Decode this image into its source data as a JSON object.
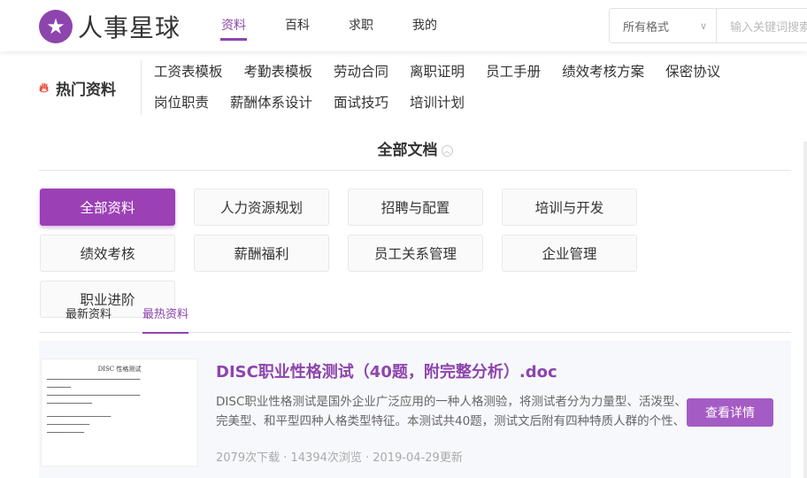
{
  "header": {
    "logo_text": "人事星球",
    "nav": [
      {
        "label": "资料",
        "active": true
      },
      {
        "label": "百科"
      },
      {
        "label": "求职"
      },
      {
        "label": "我的"
      }
    ],
    "search": {
      "format": "所有格式",
      "placeholder": "输入关键词搜索"
    }
  },
  "hot": {
    "title": "热门资料",
    "links": [
      "工资表模板",
      "考勤表模板",
      "劳动合同",
      "离职证明",
      "员工手册",
      "绩效考核方案",
      "保密协议",
      "岗位职责",
      "薪酬体系设计",
      "面试技巧",
      "培训计划"
    ]
  },
  "all_docs": {
    "title": "全部文档"
  },
  "categories": [
    "全部资料",
    "人力资源规划",
    "招聘与配置",
    "培训与开发",
    "绩效考核",
    "薪酬福利",
    "员工关系管理",
    "企业管理",
    "职业进阶"
  ],
  "tabs": [
    "最新资料",
    "最热资料"
  ],
  "document": {
    "thumb_title": "DISC 性格测试",
    "title": "DISC职业性格测试（40题，附完整分析）.doc",
    "description": "DISC职业性格测试是国外企业广泛应用的一种人格测验，将测试者分为力量型、活泼型、完美型、和平型四种人格类型特征。本测试共40题，测试文后附有四种特质人群的个性、表现和沟通方法。本测试",
    "downloads": "2079次下载",
    "views": "14394次浏览",
    "updated": "2019-04-29更新",
    "button": "查看详情"
  },
  "colors": {
    "accent": "#8e44ad",
    "button": "#a55bc4"
  }
}
